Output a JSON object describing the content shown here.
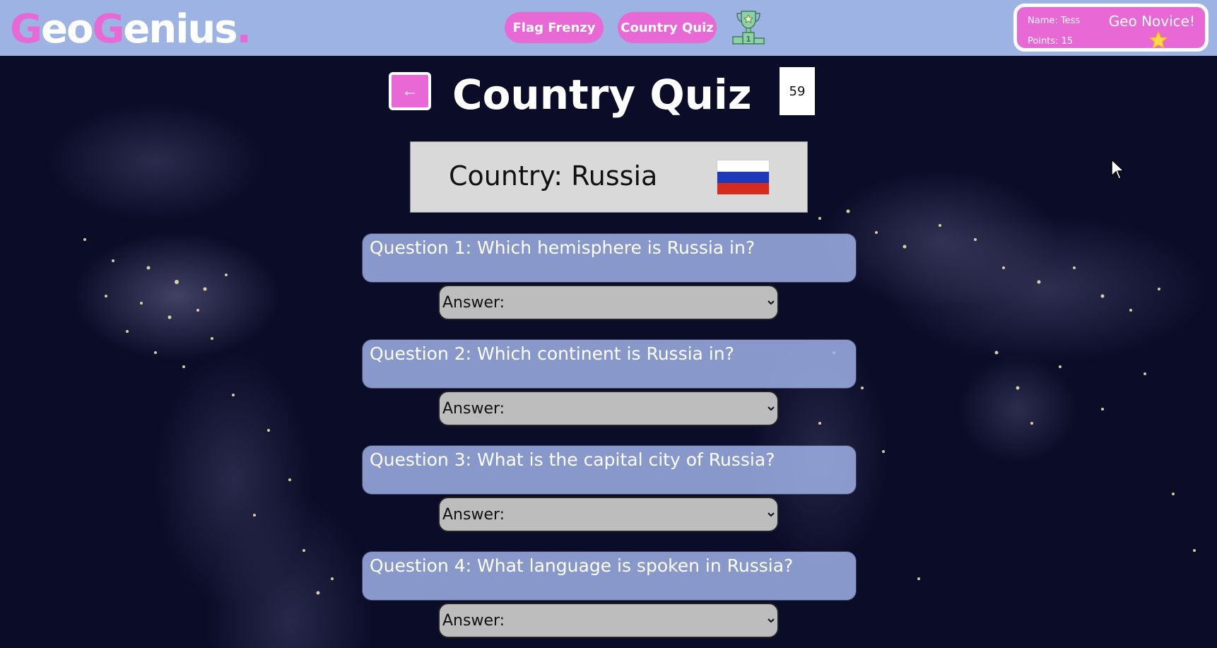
{
  "header": {
    "logo": {
      "g1": "G",
      "part1": "eo",
      "g2": "G",
      "part2": "enius",
      "dot": "."
    },
    "nav": [
      {
        "label": "Flag Frenzy"
      },
      {
        "label": "Country Quiz"
      }
    ],
    "leaderboard_icon": "trophy-icon",
    "profile": {
      "name": "Name: Tess",
      "points": "Points: 15",
      "rank": "Geo Novice!",
      "rank_icon": "star-icon"
    }
  },
  "main": {
    "back_label": "←",
    "title": "Country Quiz",
    "timer": "59",
    "country_label": "Country: Russia",
    "flag_colors": [
      "#ffffff",
      "#1c39bb",
      "#d52b1e"
    ],
    "questions": [
      {
        "text": "Question 1: Which hemisphere is Russia in?",
        "answer": "Answer:"
      },
      {
        "text": "Question 2: Which continent is Russia in?",
        "answer": "Answer:"
      },
      {
        "text": "Question 3: What is the capital city of Russia?",
        "answer": "Answer:"
      },
      {
        "text": "Question 4: What language is spoken in Russia?",
        "answer": "Answer:"
      }
    ]
  },
  "colors": {
    "accent": "#e868d6",
    "header_bg": "#9db3e3",
    "question_bg": "#a0b2e8",
    "answer_bg": "#bdbdbd"
  }
}
